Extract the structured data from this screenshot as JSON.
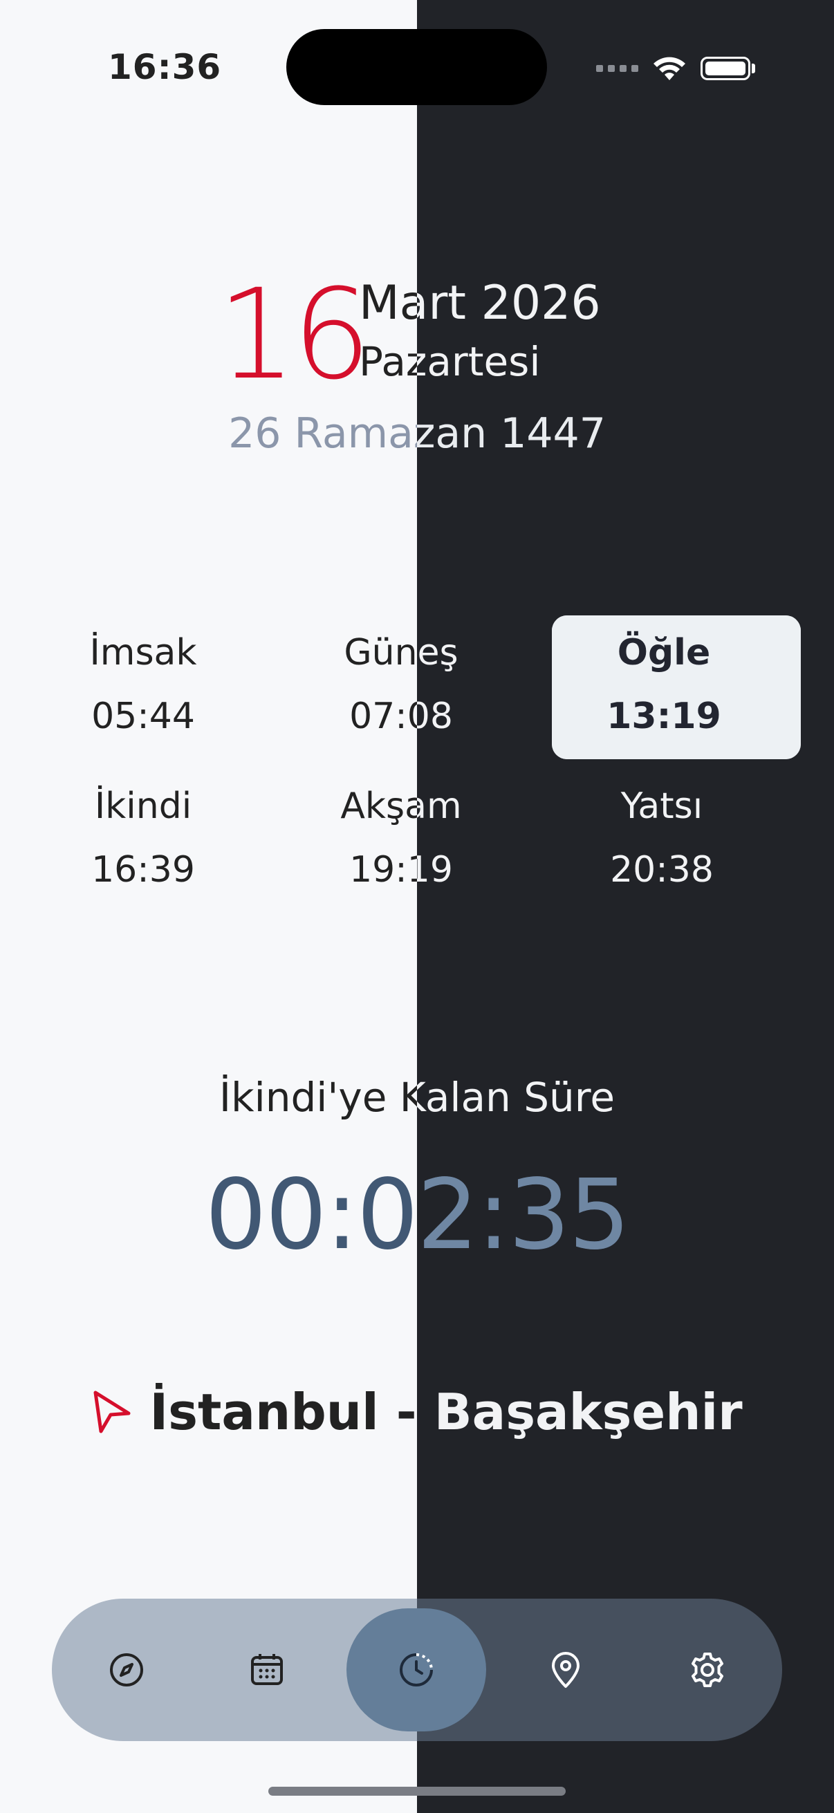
{
  "status_bar": {
    "time": "16:36"
  },
  "date": {
    "day": "16",
    "month_year": "Mart 2026",
    "weekday": "Pazartesi",
    "hijri": "26 Ramazan 1447"
  },
  "prayers": [
    {
      "name": "İmsak",
      "time": "05:44",
      "active": false
    },
    {
      "name": "Güneş",
      "time": "07:08",
      "active": false
    },
    {
      "name": "Öğle",
      "time": "13:19",
      "active": true
    },
    {
      "name": "İkindi",
      "time": "16:39",
      "active": false
    },
    {
      "name": "Akşam",
      "time": "19:19",
      "active": false
    },
    {
      "name": "Yatsı",
      "time": "20:38",
      "active": false
    }
  ],
  "countdown": {
    "label": "İkindi'ye Kalan Süre",
    "value": "00:02:35"
  },
  "location": {
    "name": "İstanbul - Başakşehir",
    "icon": "location-arrow-icon"
  },
  "tabs": [
    {
      "id": "compass",
      "icon": "compass-icon",
      "active": false
    },
    {
      "id": "calendar",
      "icon": "calendar-icon",
      "active": false
    },
    {
      "id": "clock",
      "icon": "clock-icon",
      "active": true
    },
    {
      "id": "location",
      "icon": "map-pin-icon",
      "active": false
    },
    {
      "id": "settings",
      "icon": "gear-icon",
      "active": false
    }
  ],
  "colors": {
    "accent_red": "#d50f2c",
    "light_bg": "#f7f8fa",
    "dark_bg": "#212328",
    "countdown_blue": "#415874"
  }
}
